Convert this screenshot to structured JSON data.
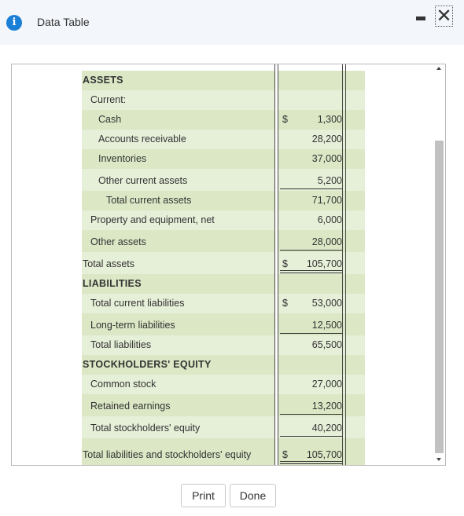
{
  "window": {
    "title": "Data Table",
    "info_icon": "info-icon",
    "minimize_icon": "minimize-icon",
    "close_icon": "close-icon",
    "close_glyph": "✕"
  },
  "table": {
    "rows": [
      {
        "label": "ASSETS",
        "indent": 0,
        "heading": true
      },
      {
        "label": "Current:",
        "indent": 1
      },
      {
        "label": "Cash",
        "indent": 2,
        "dollar": "$",
        "value": "1,300"
      },
      {
        "label": "Accounts receivable",
        "indent": 2,
        "value": "28,200"
      },
      {
        "label": "Inventories",
        "indent": 2,
        "value": "37,000"
      },
      {
        "label": "Other current assets",
        "indent": 2,
        "value": "5,200",
        "underline": "single"
      },
      {
        "label": "Total current assets",
        "indent": 3,
        "value": "71,700"
      },
      {
        "label": "Property and equipment, net",
        "indent": 1,
        "value": "6,000"
      },
      {
        "label": "Other assets",
        "indent": 1,
        "value": "28,000",
        "underline": "single"
      },
      {
        "label": "Total assets",
        "indent": 0,
        "dollar": "$",
        "value": "105,700",
        "underline": "double"
      },
      {
        "label": "LIABILITIES",
        "indent": 0,
        "heading": true
      },
      {
        "label": "Total current liabilities",
        "indent": 1,
        "dollar": "$",
        "value": "53,000"
      },
      {
        "label": "Long-term liabilities",
        "indent": 1,
        "value": "12,500",
        "underline": "single"
      },
      {
        "label": "Total liabilities",
        "indent": 1,
        "value": "65,500"
      },
      {
        "label": "STOCKHOLDERS' EQUITY",
        "indent": 0,
        "heading": true
      },
      {
        "label": "Common stock",
        "indent": 1,
        "value": "27,000"
      },
      {
        "label": "Retained earnings",
        "indent": 1,
        "value": "13,200",
        "underline": "single"
      },
      {
        "label": "Total stockholders' equity",
        "indent": 1,
        "value": "40,200",
        "underline": "single"
      },
      {
        "label": "Total liabilities and stockholders' equity",
        "indent": 0,
        "dollar": "$",
        "value": "105,700",
        "underline": "double"
      }
    ]
  },
  "buttons": {
    "print": "Print",
    "done": "Done"
  }
}
